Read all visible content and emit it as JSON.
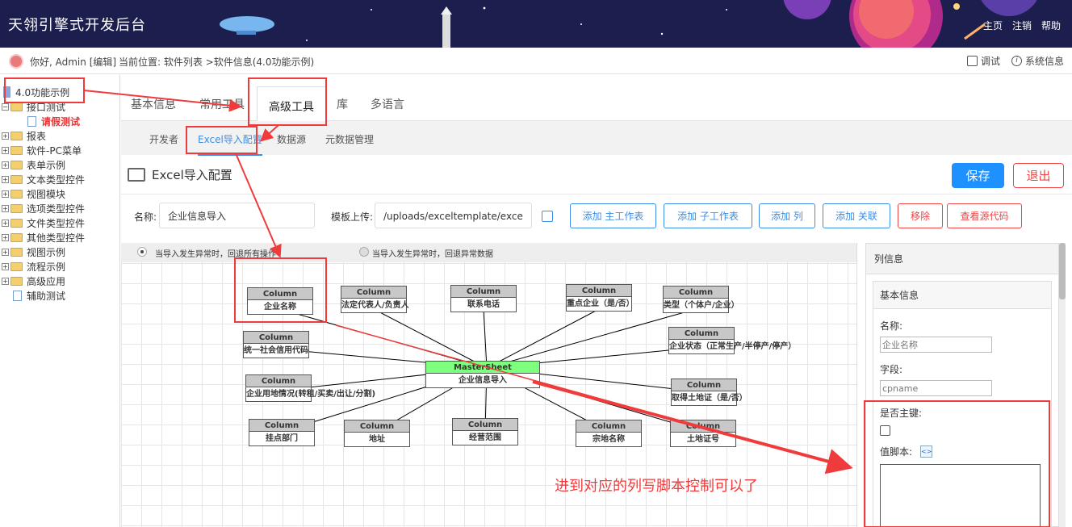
{
  "header": {
    "app_title": "天翎引擎式开发后台",
    "links": [
      "主页",
      "注销",
      "帮助"
    ]
  },
  "subbar": {
    "greeting": "你好, Admin [编辑]",
    "breadcrumb": "当前位置: 软件列表 >软件信息(4.0功能示例)",
    "debug_label": "调试",
    "sysinfo_label": "系统信息"
  },
  "sidebar": {
    "root": "4.0功能示例",
    "interface_test": "接口测试",
    "leave_test": "请假测试",
    "items": [
      "报表",
      "软件-PC菜单",
      "表单示例",
      "文本类型控件",
      "视图模块",
      "选项类型控件",
      "文件类型控件",
      "其他类型控件",
      "视图示例",
      "流程示例",
      "高级应用"
    ],
    "aux_test": "辅助测试"
  },
  "tabs": {
    "primary": [
      "基本信息",
      "常用工具",
      "高级工具",
      "库",
      "多语言"
    ],
    "secondary": [
      "开发者",
      "Excel导入配置",
      "数据源",
      "元数据管理"
    ]
  },
  "section": {
    "title": "Excel导入配置",
    "save": "保存",
    "exit": "退出"
  },
  "form": {
    "name_label": "名称:",
    "name_value": "企业信息导入",
    "template_label": "模板上传:",
    "template_value": "/uploads/exceltemplate/excel导入导",
    "buttons": [
      "添加 主工作表",
      "添加 子工作表",
      "添加 列",
      "添加 关联",
      "移除",
      "查看源代码"
    ]
  },
  "canvas": {
    "radio_on": "当导入发生异常时，回退所有操作",
    "radio_off": "当导入发生异常时，回退异常数据",
    "column_header": "Column",
    "master_header": "MasterSheet",
    "master_name": "企业信息导入",
    "columns": [
      "企业名称",
      "法定代表人/负责人",
      "联系电话",
      "重点企业（是/否）",
      "类型（个体户/企业）",
      "统一社会信用代码",
      "企业状态（正常生产/半停产/停产）",
      "企业用地情况(转租/买卖/出让/分割)",
      "取得土地证（是/否）",
      "挂点部门",
      "地址",
      "经营范围",
      "宗地名称",
      "土地证号"
    ]
  },
  "column_panel": {
    "title": "列信息",
    "section": "基本信息",
    "name_label": "名称:",
    "name_placeholder": "企业名称",
    "field_label": "字段:",
    "field_placeholder": "cpname",
    "primary_key_label": "是否主键:",
    "script_label": "值脚本:"
  },
  "annotation": "进到对应的列写脚本控制可以了",
  "colors": {
    "header_bg": "#1c1f4d",
    "accent": "#1e90ff",
    "danger": "#e44444",
    "highlight": "#ef3b3b",
    "master": "#7eff7e"
  }
}
